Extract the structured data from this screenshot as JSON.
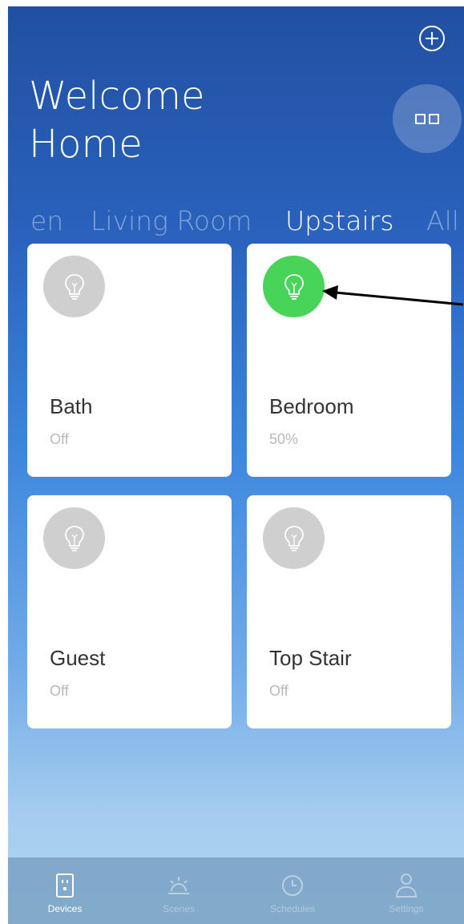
{
  "header": {
    "title_line1": "Welcome",
    "title_line2": "Home"
  },
  "icons": {
    "add": "plus-circle-icon",
    "view_toggle": "grid-view-icon",
    "bulb": "lightbulb-icon"
  },
  "tabs": [
    {
      "label": "en",
      "active": false
    },
    {
      "label": "Living Room",
      "active": false
    },
    {
      "label": "Upstairs",
      "active": true
    },
    {
      "label": "All",
      "active": false
    }
  ],
  "devices": [
    {
      "name": "Bath",
      "status": "Off",
      "on": false,
      "level_percent": 0
    },
    {
      "name": "Bedroom",
      "status": "50%",
      "on": true,
      "level_percent": 50
    },
    {
      "name": "Guest",
      "status": "Off",
      "on": false,
      "level_percent": 0
    },
    {
      "name": "Top Stair",
      "status": "Off",
      "on": false,
      "level_percent": 0
    }
  ],
  "bottom_nav": [
    {
      "label": "Devices",
      "icon": "outlet-icon",
      "active": true
    },
    {
      "label": "Scenes",
      "icon": "sunrise-icon",
      "active": false
    },
    {
      "label": "Schedules",
      "icon": "clock-icon",
      "active": false
    },
    {
      "label": "Settings",
      "icon": "person-icon",
      "active": false
    }
  ],
  "colors": {
    "bulb_on": "#47d459",
    "bulb_off": "#cfcfcf",
    "background_top": "#2150a2",
    "background_bottom": "#b3d5f2"
  }
}
